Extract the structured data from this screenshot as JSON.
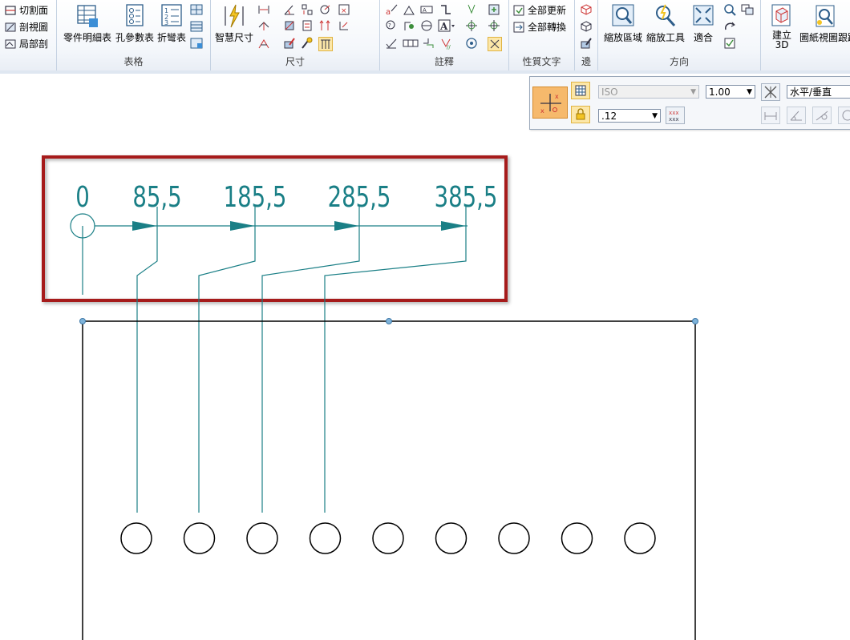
{
  "ribbon": {
    "section_group": {
      "items": [
        "切割面",
        "剖視圖",
        "局部剖"
      ]
    },
    "table_group": {
      "label": "表格",
      "buttons": [
        "零件明細表",
        "孔參數表",
        "折彎表"
      ]
    },
    "dimension_group": {
      "label": "尺寸",
      "smart_dimension": "智慧尺寸"
    },
    "annotation_group": {
      "label": "註釋"
    },
    "property_text_group": {
      "label": "性質文字",
      "update_all": "全部更新",
      "convert_all": "全部轉換"
    },
    "edge_group": {
      "label": "邊"
    },
    "orientation_group": {
      "label": "方向",
      "buttons": [
        "縮放區域",
        "縮放工具",
        "適合"
      ]
    },
    "create_group": {
      "create_3d_line1": "建立",
      "create_3d_line2": "3D",
      "drawing_view_tracker": "圖紙視圖跟蹤"
    }
  },
  "command_bar": {
    "style_value": "ISO",
    "scale_value": "1.00",
    "orientation_value": "水平/垂直",
    "precision_value": ".12"
  },
  "drawing": {
    "dimension_labels": [
      "0",
      "85,5",
      "185,5",
      "285,5",
      "385,5"
    ],
    "hole_count": 9,
    "colors": {
      "dimension": "#1a7f86",
      "highlight_box": "#a61b1b",
      "geometry": "#000000",
      "handles": "#7fb3d9"
    }
  }
}
